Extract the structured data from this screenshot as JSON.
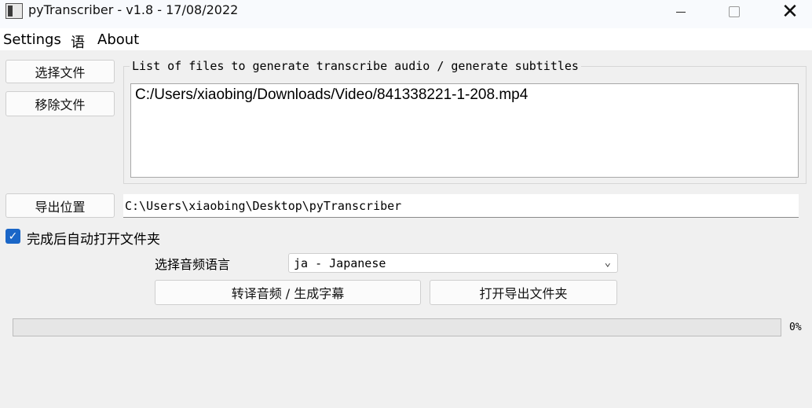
{
  "window": {
    "title": "pyTranscriber - v1.8 - 17/08/2022",
    "controls": [
      "minimize",
      "maximize",
      "close"
    ],
    "close_glyph": "✕"
  },
  "menu": {
    "settings": "Settings",
    "language": "语",
    "about": "About"
  },
  "buttons": {
    "select_files": "选择文件",
    "remove_files": "移除文件",
    "output_location": "导出位置",
    "transcribe": "转译音频 / 生成字幕",
    "open_output_folder": "打开导出文件夹"
  },
  "file_list": {
    "title": "List of files to generate transcribe audio / generate subtitles",
    "items": [
      "C:/Users/xiaobing/Downloads/Video/841338221-1-208.mp4"
    ]
  },
  "output": {
    "path": "C:\\Users\\xiaobing\\Desktop\\pyTranscriber"
  },
  "options": {
    "auto_open_checked": true,
    "auto_open_label": "完成后自动打开文件夹",
    "check_glyph": "✓",
    "language_label": "选择音频语言",
    "language_value": "ja - Japanese",
    "dropdown_glyph": "⌄"
  },
  "progress": {
    "value": 0,
    "text": "0%"
  },
  "colors": {
    "accent": "#1a66c7",
    "window_bg": "#f0f0f0"
  }
}
